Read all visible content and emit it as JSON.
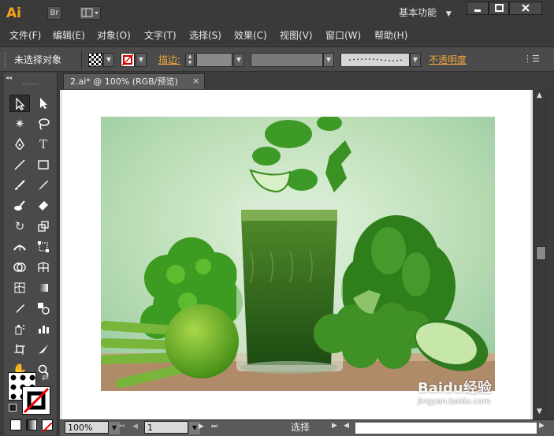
{
  "app": {
    "logo": "Ai",
    "bridge_button": "Br",
    "workspace": "基本功能"
  },
  "menu": [
    "文件(F)",
    "编辑(E)",
    "对象(O)",
    "文字(T)",
    "选择(S)",
    "效果(C)",
    "视图(V)",
    "窗口(W)",
    "帮助(H)"
  ],
  "control": {
    "selection_status": "未选择对象",
    "stroke_label": "描边:",
    "opacity_link": "不透明度"
  },
  "document": {
    "tab_title": "2.ai* @ 100% (RGB/预览)",
    "close": "×"
  },
  "status": {
    "zoom": "100%",
    "page": "1",
    "tool": "选择"
  },
  "watermark": {
    "brand": "Baidu经验",
    "url": "jingyan.baidu.com"
  },
  "colors": {
    "app_bg": "#3c3c3c",
    "accent_orange": "#f7a21b",
    "link_orange": "#f0a640",
    "artboard": "#ffffff"
  },
  "tools": [
    [
      "selection-tool",
      "direct-selection-tool"
    ],
    [
      "magic-wand-tool",
      "lasso-tool"
    ],
    [
      "pen-tool",
      "type-tool"
    ],
    [
      "line-segment-tool",
      "rectangle-tool"
    ],
    [
      "paintbrush-tool",
      "pencil-tool"
    ],
    [
      "blob-brush-tool",
      "eraser-tool"
    ],
    [
      "rotate-tool",
      "scale-tool"
    ],
    [
      "width-tool",
      "free-transform-tool"
    ],
    [
      "shape-builder-tool",
      "perspective-grid-tool"
    ],
    [
      "mesh-tool",
      "gradient-tool"
    ],
    [
      "eyedropper-tool",
      "blend-tool"
    ],
    [
      "symbol-sprayer-tool",
      "column-graph-tool"
    ],
    [
      "artboard-tool",
      "slice-tool"
    ],
    [
      "hand-tool",
      "zoom-tool"
    ]
  ]
}
